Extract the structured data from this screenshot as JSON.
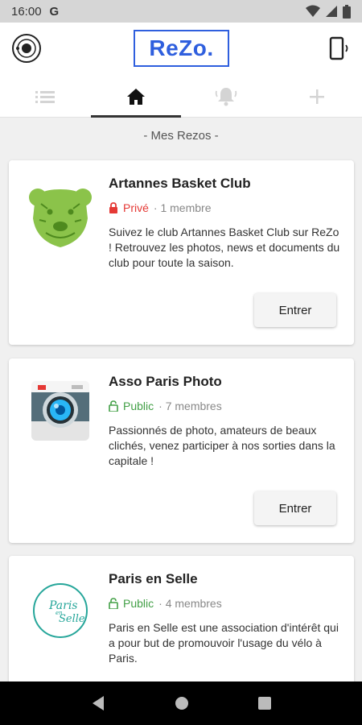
{
  "status": {
    "time": "16:00",
    "g": "G"
  },
  "app": {
    "logo": "ReZo."
  },
  "tabs": [
    {
      "icon": "list-icon",
      "active": false
    },
    {
      "icon": "home-icon",
      "active": true
    },
    {
      "icon": "bell-icon",
      "active": false
    },
    {
      "icon": "plus-icon",
      "active": false
    }
  ],
  "section": {
    "title": "- Mes Rezos -"
  },
  "cards": [
    {
      "name": "Artannes Basket Club",
      "visibility": "Privé",
      "members": "· 1 membre",
      "description": "Suivez le club Artannes Basket Club sur ReZo ! Retrouvez les photos, news et documents du club pour toute la saison.",
      "button": "Entrer"
    },
    {
      "name": "Asso Paris Photo",
      "visibility": "Public",
      "members": "· 7 membres",
      "description": "Passionnés de photo, amateurs de beaux clichés, venez participer à nos sorties dans la capitale !",
      "button": "Entrer"
    },
    {
      "name": "Paris en Selle",
      "visibility": "Public",
      "members": "· 4 membres",
      "description": "Paris en Selle est une association d'intérêt qui a pour but de promouvoir l'usage du vélo à Paris.",
      "logo_text": "Paris en Selle"
    }
  ],
  "colors": {
    "brand": "#2f5fde",
    "private": "#e53935",
    "public": "#43a047"
  }
}
